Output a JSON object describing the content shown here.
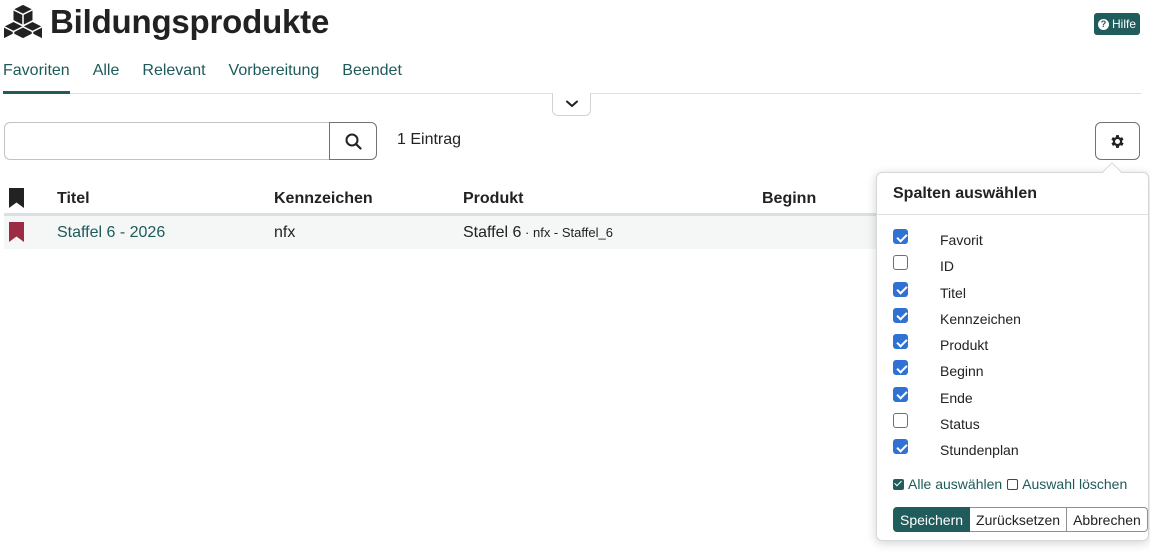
{
  "page": {
    "title": "Bildungsprodukte",
    "help_label": "Hilfe"
  },
  "tabs": [
    {
      "label": "Favoriten",
      "active": true
    },
    {
      "label": "Alle",
      "active": false
    },
    {
      "label": "Relevant",
      "active": false
    },
    {
      "label": "Vorbereitung",
      "active": false
    },
    {
      "label": "Beendet",
      "active": false
    }
  ],
  "search": {
    "value": "",
    "placeholder": ""
  },
  "result_count": "1 Eintrag",
  "table": {
    "headers": [
      "Titel",
      "Kennzeichen",
      "Produkt",
      "Beginn"
    ],
    "rows": [
      {
        "favorite": true,
        "title": "Staffel 6 - 2026",
        "kennzeichen": "nfx",
        "produkt": "Staffel 6",
        "produkt_sub": " · nfx - Staffel_6",
        "beginn": ""
      }
    ]
  },
  "column_chooser": {
    "title": "Spalten auswählen",
    "columns": [
      {
        "label": "Favorit",
        "checked": true
      },
      {
        "label": "ID",
        "checked": false
      },
      {
        "label": "Titel",
        "checked": true
      },
      {
        "label": "Kennzeichen",
        "checked": true
      },
      {
        "label": "Produkt",
        "checked": true
      },
      {
        "label": "Beginn",
        "checked": true
      },
      {
        "label": "Ende",
        "checked": true
      },
      {
        "label": "Status",
        "checked": false
      },
      {
        "label": "Stundenplan",
        "checked": true
      }
    ],
    "select_all": "Alle auswählen",
    "clear_selection": "Auswahl löschen",
    "save": "Speichern",
    "reset": "Zurücksetzen",
    "cancel": "Abbrechen"
  },
  "colors": {
    "accent": "#215c5c",
    "link": "#1e5a5a",
    "bookmark_active": "#9b2c44",
    "checkbox": "#2f72d4"
  },
  "icons": {
    "logo": "cubes-icon",
    "help": "question-circle-icon",
    "expand": "chevron-down-icon",
    "search": "search-icon",
    "settings": "gear-icon",
    "bookmark": "bookmark-icon"
  }
}
